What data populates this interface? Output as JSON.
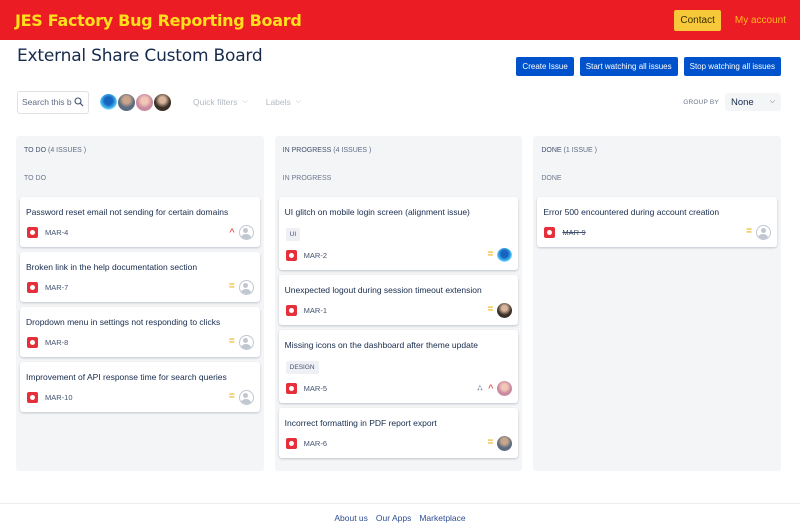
{
  "topbar": {
    "brand": "JES Factory Bug Reporting Board",
    "contact_label": "Contact",
    "account_label": "My account",
    "brand_color": "#ec1c24",
    "brand_text_color": "#ffe01b"
  },
  "header": {
    "title": "External Share Custom Board",
    "actions": {
      "create": "Create Issue",
      "start_watch": "Start watching all issues",
      "stop_watch": "Stop watching all issues"
    }
  },
  "filters": {
    "search_placeholder": "Search this b",
    "quick_filters": "Quick filters",
    "labels": "Labels",
    "group_by_label": "GROUP BY",
    "group_by_value": "None"
  },
  "columns": [
    {
      "name": "TO DO",
      "count": "(4 ISSUES )",
      "status": "TO DO",
      "cards": [
        {
          "title": "Password reset email not sending for certain domains",
          "key": "MAR-4",
          "priority": "high",
          "assignee": "unassigned"
        },
        {
          "title": "Broken link in the help documentation section",
          "key": "MAR-7",
          "priority": "medium",
          "assignee": "unassigned"
        },
        {
          "title": "Dropdown menu in settings not responding to clicks",
          "key": "MAR-8",
          "priority": "medium",
          "assignee": "unassigned"
        },
        {
          "title": "Improvement of API response time for search queries",
          "key": "MAR-10",
          "priority": "medium",
          "assignee": "unassigned"
        }
      ]
    },
    {
      "name": "IN PROGRESS",
      "count": "(4 ISSUES )",
      "status": "IN PROGRESS",
      "cards": [
        {
          "title": "UI glitch on mobile login screen (alignment issue)",
          "label": "UI",
          "key": "MAR-2",
          "priority": "medium",
          "assignee": "robot-avatar"
        },
        {
          "title": "Unexpected logout during session timeout extension",
          "key": "MAR-1",
          "priority": "medium",
          "assignee": "user-avatar"
        },
        {
          "title": "Missing icons on the dashboard after theme update",
          "label": "DESIGN",
          "key": "MAR-5",
          "priority": "high",
          "has_subtasks": true,
          "assignee": "user-avatar"
        },
        {
          "title": "Incorrect formatting in PDF report export",
          "key": "MAR-6",
          "priority": "medium",
          "assignee": "user-avatar"
        }
      ]
    },
    {
      "name": "DONE",
      "count": "(1 ISSUE )",
      "status": "DONE",
      "cards": [
        {
          "title": "Error 500 encountered during account creation",
          "key": "MAR-9",
          "priority": "medium",
          "assignee": "unassigned",
          "resolved": true
        }
      ]
    }
  ],
  "icons": {
    "priority_medium": "=",
    "priority_high": "^",
    "subtask": "⛼"
  },
  "footer": {
    "links": [
      "About us",
      "Our Apps",
      "Marketplace"
    ]
  }
}
